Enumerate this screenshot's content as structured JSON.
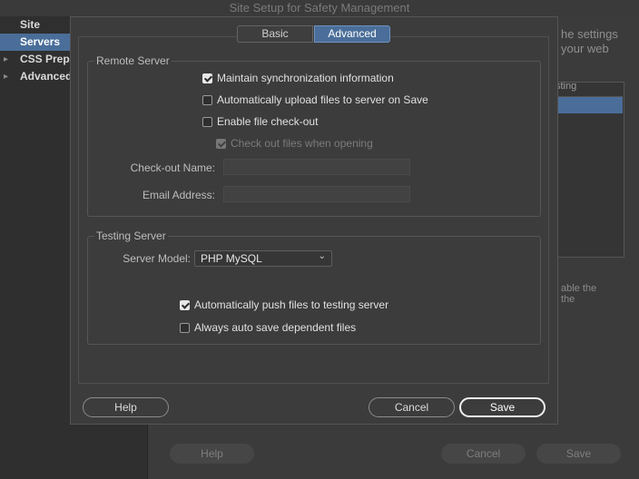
{
  "window": {
    "title": "Site Setup for Safety Management"
  },
  "background": {
    "nav": [
      {
        "label": "Site",
        "selected": false,
        "expandable": false
      },
      {
        "label": "Servers",
        "selected": true,
        "expandable": false
      },
      {
        "label": "CSS Prepro",
        "selected": false,
        "expandable": true
      },
      {
        "label": "Advanced",
        "selected": false,
        "expandable": true
      }
    ],
    "desc_line1": "he settings",
    "desc_line2": "your web",
    "table_col": "sting",
    "side_text1": "able the",
    "side_text2": "the",
    "buttons": {
      "help": "Help",
      "cancel": "Cancel",
      "save": "Save"
    }
  },
  "tabs": [
    {
      "label": "Basic",
      "active": false
    },
    {
      "label": "Advanced",
      "active": true
    }
  ],
  "remote_server": {
    "title": "Remote Server",
    "options": [
      {
        "label": "Maintain synchronization information",
        "checked": true,
        "disabled": false
      },
      {
        "label": "Automatically upload files to server on Save",
        "checked": false,
        "disabled": false
      },
      {
        "label": "Enable file check-out",
        "checked": false,
        "disabled": false
      },
      {
        "label": "Check out files when opening",
        "checked": true,
        "disabled": true
      }
    ],
    "checkout_name_label": "Check-out Name:",
    "checkout_name_value": "",
    "email_label": "Email Address:",
    "email_value": ""
  },
  "testing_server": {
    "title": "Testing Server",
    "model_label": "Server Model:",
    "model_value": "PHP MySQL",
    "options": [
      {
        "label": "Automatically push files to testing server",
        "checked": true
      },
      {
        "label": "Always auto save dependent files",
        "checked": false
      }
    ]
  },
  "buttons": {
    "help": "Help",
    "cancel": "Cancel",
    "save": "Save"
  },
  "colors": {
    "accent": "#4a6e99",
    "dialog_bg": "#3c3c3c"
  }
}
